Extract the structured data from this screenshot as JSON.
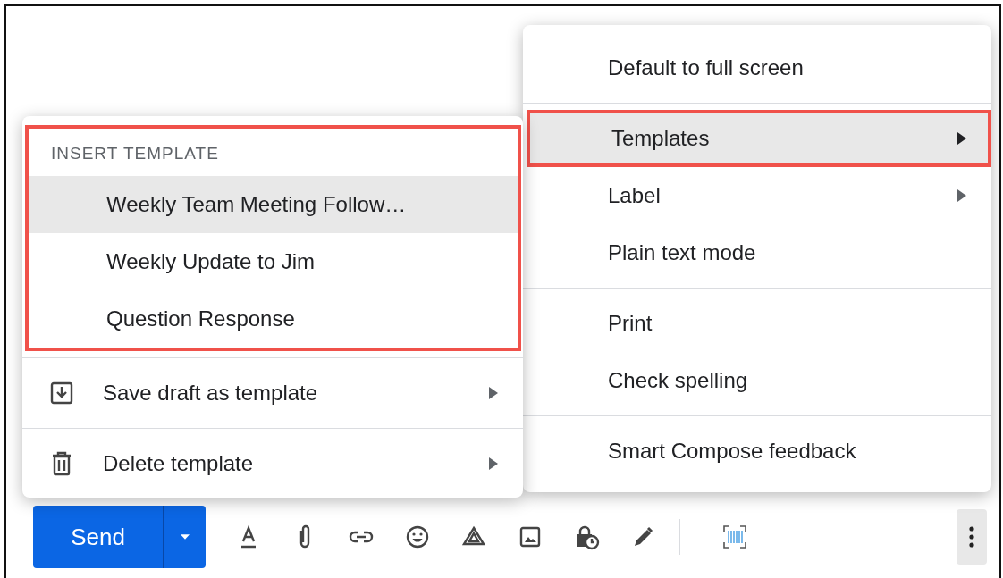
{
  "compose_toolbar": {
    "send_label": "Send"
  },
  "more_menu": {
    "groups": [
      [
        {
          "label": "Default to full screen",
          "selected": false,
          "submenu": false,
          "outlined": false
        }
      ],
      [
        {
          "label": "Templates",
          "selected": true,
          "submenu": true,
          "outlined": true
        },
        {
          "label": "Label",
          "selected": false,
          "submenu": true,
          "outlined": false
        },
        {
          "label": "Plain text mode",
          "selected": false,
          "submenu": false,
          "outlined": false
        }
      ],
      [
        {
          "label": "Print",
          "selected": false,
          "submenu": false,
          "outlined": false
        },
        {
          "label": "Check spelling",
          "selected": false,
          "submenu": false,
          "outlined": false
        }
      ],
      [
        {
          "label": "Smart Compose feedback",
          "selected": false,
          "submenu": false,
          "outlined": false
        }
      ]
    ]
  },
  "templates_menu": {
    "insert_template": {
      "header": "INSERT TEMPLATE",
      "outlined": true,
      "items": [
        {
          "label": "Weekly Team Meeting Follow…",
          "selected": true
        },
        {
          "label": "Weekly Update to Jim",
          "selected": false
        },
        {
          "label": "Question Response",
          "selected": false
        }
      ]
    },
    "actions": [
      {
        "label": "Save draft as template",
        "kind": "save",
        "submenu": true
      },
      {
        "label": "Delete template",
        "kind": "delete",
        "submenu": true
      }
    ]
  }
}
